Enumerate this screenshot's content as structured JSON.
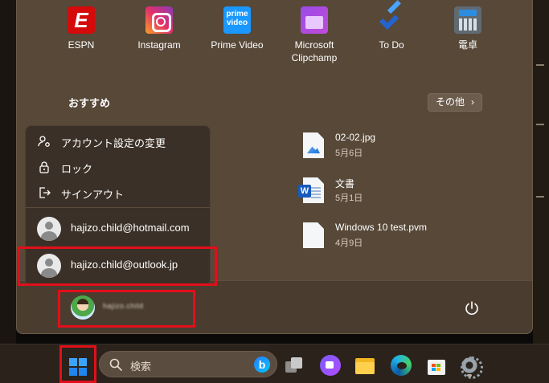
{
  "pinned_apps": [
    {
      "label": "ESPN",
      "icon": "espn-icon"
    },
    {
      "label": "Instagram",
      "icon": "instagram-icon"
    },
    {
      "label": "Prime Video",
      "icon": "prime-video-icon"
    },
    {
      "label": "Microsoft\nClipchamp",
      "icon": "clipchamp-icon"
    },
    {
      "label": "To Do",
      "icon": "todo-icon"
    },
    {
      "label": "電卓",
      "icon": "calculator-icon"
    }
  ],
  "recommended": {
    "title": "おすすめ",
    "more_label": "その他",
    "items": [
      {
        "name": "02-02.jpg",
        "date": "5月6日",
        "icon": "image-file-icon"
      },
      {
        "name": "文書",
        "date": "5月1日",
        "icon": "word-file-icon"
      },
      {
        "name": "Windows 10 test.pvm",
        "date": "4月9日",
        "icon": "blank-file-icon"
      }
    ]
  },
  "account_menu": {
    "items": [
      {
        "label": "アカウント設定の変更",
        "icon": "account-settings-icon"
      },
      {
        "label": "ロック",
        "icon": "lock-icon"
      },
      {
        "label": "サインアウト",
        "icon": "sign-out-icon"
      }
    ],
    "accounts": [
      {
        "email": "hajizo.child@hotmail.com"
      },
      {
        "email": "hajizo.child@outlook.jp"
      }
    ]
  },
  "user": {
    "name": "hajizo.child"
  },
  "taskbar": {
    "search_placeholder": "検索"
  },
  "colors": {
    "highlight": "#e10f1a",
    "start_menu_bg": "#574838",
    "flyout_bg": "#3b3027",
    "taskbar_bg": "#2a221b"
  }
}
